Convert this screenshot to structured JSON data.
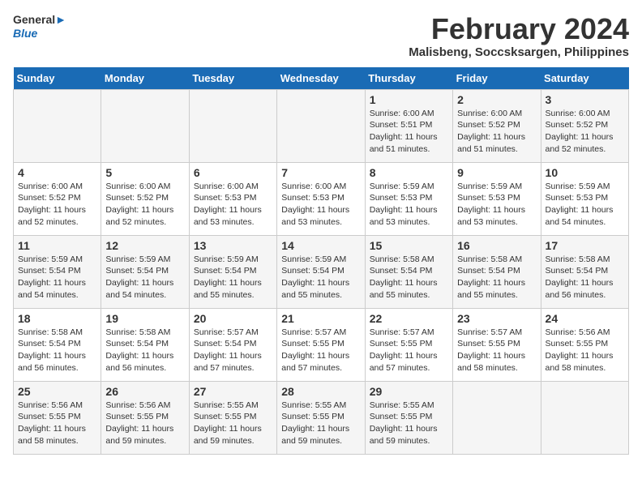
{
  "header": {
    "logo_line1": "General",
    "logo_line2": "Blue",
    "month_year": "February 2024",
    "location": "Malisbeng, Soccsksargen, Philippines"
  },
  "days_of_week": [
    "Sunday",
    "Monday",
    "Tuesday",
    "Wednesday",
    "Thursday",
    "Friday",
    "Saturday"
  ],
  "weeks": [
    [
      {
        "num": "",
        "info": ""
      },
      {
        "num": "",
        "info": ""
      },
      {
        "num": "",
        "info": ""
      },
      {
        "num": "",
        "info": ""
      },
      {
        "num": "1",
        "info": "Sunrise: 6:00 AM\nSunset: 5:51 PM\nDaylight: 11 hours\nand 51 minutes."
      },
      {
        "num": "2",
        "info": "Sunrise: 6:00 AM\nSunset: 5:52 PM\nDaylight: 11 hours\nand 51 minutes."
      },
      {
        "num": "3",
        "info": "Sunrise: 6:00 AM\nSunset: 5:52 PM\nDaylight: 11 hours\nand 52 minutes."
      }
    ],
    [
      {
        "num": "4",
        "info": "Sunrise: 6:00 AM\nSunset: 5:52 PM\nDaylight: 11 hours\nand 52 minutes."
      },
      {
        "num": "5",
        "info": "Sunrise: 6:00 AM\nSunset: 5:52 PM\nDaylight: 11 hours\nand 52 minutes."
      },
      {
        "num": "6",
        "info": "Sunrise: 6:00 AM\nSunset: 5:53 PM\nDaylight: 11 hours\nand 53 minutes."
      },
      {
        "num": "7",
        "info": "Sunrise: 6:00 AM\nSunset: 5:53 PM\nDaylight: 11 hours\nand 53 minutes."
      },
      {
        "num": "8",
        "info": "Sunrise: 5:59 AM\nSunset: 5:53 PM\nDaylight: 11 hours\nand 53 minutes."
      },
      {
        "num": "9",
        "info": "Sunrise: 5:59 AM\nSunset: 5:53 PM\nDaylight: 11 hours\nand 53 minutes."
      },
      {
        "num": "10",
        "info": "Sunrise: 5:59 AM\nSunset: 5:53 PM\nDaylight: 11 hours\nand 54 minutes."
      }
    ],
    [
      {
        "num": "11",
        "info": "Sunrise: 5:59 AM\nSunset: 5:54 PM\nDaylight: 11 hours\nand 54 minutes."
      },
      {
        "num": "12",
        "info": "Sunrise: 5:59 AM\nSunset: 5:54 PM\nDaylight: 11 hours\nand 54 minutes."
      },
      {
        "num": "13",
        "info": "Sunrise: 5:59 AM\nSunset: 5:54 PM\nDaylight: 11 hours\nand 55 minutes."
      },
      {
        "num": "14",
        "info": "Sunrise: 5:59 AM\nSunset: 5:54 PM\nDaylight: 11 hours\nand 55 minutes."
      },
      {
        "num": "15",
        "info": "Sunrise: 5:58 AM\nSunset: 5:54 PM\nDaylight: 11 hours\nand 55 minutes."
      },
      {
        "num": "16",
        "info": "Sunrise: 5:58 AM\nSunset: 5:54 PM\nDaylight: 11 hours\nand 55 minutes."
      },
      {
        "num": "17",
        "info": "Sunrise: 5:58 AM\nSunset: 5:54 PM\nDaylight: 11 hours\nand 56 minutes."
      }
    ],
    [
      {
        "num": "18",
        "info": "Sunrise: 5:58 AM\nSunset: 5:54 PM\nDaylight: 11 hours\nand 56 minutes."
      },
      {
        "num": "19",
        "info": "Sunrise: 5:58 AM\nSunset: 5:54 PM\nDaylight: 11 hours\nand 56 minutes."
      },
      {
        "num": "20",
        "info": "Sunrise: 5:57 AM\nSunset: 5:54 PM\nDaylight: 11 hours\nand 57 minutes."
      },
      {
        "num": "21",
        "info": "Sunrise: 5:57 AM\nSunset: 5:55 PM\nDaylight: 11 hours\nand 57 minutes."
      },
      {
        "num": "22",
        "info": "Sunrise: 5:57 AM\nSunset: 5:55 PM\nDaylight: 11 hours\nand 57 minutes."
      },
      {
        "num": "23",
        "info": "Sunrise: 5:57 AM\nSunset: 5:55 PM\nDaylight: 11 hours\nand 58 minutes."
      },
      {
        "num": "24",
        "info": "Sunrise: 5:56 AM\nSunset: 5:55 PM\nDaylight: 11 hours\nand 58 minutes."
      }
    ],
    [
      {
        "num": "25",
        "info": "Sunrise: 5:56 AM\nSunset: 5:55 PM\nDaylight: 11 hours\nand 58 minutes."
      },
      {
        "num": "26",
        "info": "Sunrise: 5:56 AM\nSunset: 5:55 PM\nDaylight: 11 hours\nand 59 minutes."
      },
      {
        "num": "27",
        "info": "Sunrise: 5:55 AM\nSunset: 5:55 PM\nDaylight: 11 hours\nand 59 minutes."
      },
      {
        "num": "28",
        "info": "Sunrise: 5:55 AM\nSunset: 5:55 PM\nDaylight: 11 hours\nand 59 minutes."
      },
      {
        "num": "29",
        "info": "Sunrise: 5:55 AM\nSunset: 5:55 PM\nDaylight: 11 hours\nand 59 minutes."
      },
      {
        "num": "",
        "info": ""
      },
      {
        "num": "",
        "info": ""
      }
    ]
  ]
}
